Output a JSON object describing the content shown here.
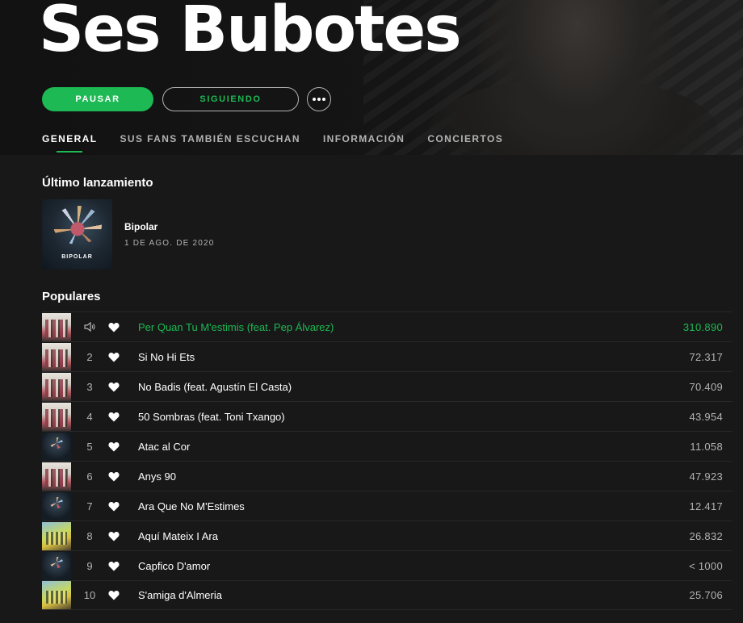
{
  "artist": {
    "name": "Ses Bubotes"
  },
  "actions": {
    "play_label": "PAUSAR",
    "follow_label": "SIGUIENDO"
  },
  "tabs": [
    {
      "label": "GENERAL",
      "active": true
    },
    {
      "label": "SUS FANS TAMBIÉN ESCUCHAN",
      "active": false
    },
    {
      "label": "INFORMACIÓN",
      "active": false
    },
    {
      "label": "CONCIERTOS",
      "active": false
    }
  ],
  "latest_release": {
    "heading": "Último lanzamiento",
    "cover_text": "BIPOLAR",
    "title": "Bipolar",
    "date": "1 DE AGO. DE 2020"
  },
  "popular": {
    "heading": "Populares",
    "tracks": [
      {
        "number": "1",
        "title": "Per Quan Tu M'estimis (feat. Pep Álvarez)",
        "plays": "310.890",
        "playing": true
      },
      {
        "number": "2",
        "title": "Si No Hi Ets",
        "plays": "72.317"
      },
      {
        "number": "3",
        "title": "No Badis (feat. Agustín El Casta)",
        "plays": "70.409"
      },
      {
        "number": "4",
        "title": "50 Sombras (feat. Toni Txango)",
        "plays": "43.954"
      },
      {
        "number": "5",
        "title": "Atac al Cor",
        "plays": "11.058"
      },
      {
        "number": "6",
        "title": "Anys 90",
        "plays": "47.923"
      },
      {
        "number": "7",
        "title": "Ara Que No M'Estimes",
        "plays": "12.417"
      },
      {
        "number": "8",
        "title": "Aquí Mateix I Ara",
        "plays": "26.832"
      },
      {
        "number": "9",
        "title": "Capfico D'amor",
        "plays": "< 1000"
      },
      {
        "number": "10",
        "title": "S'amiga d'Almeria",
        "plays": "25.706"
      }
    ]
  },
  "colors": {
    "accent": "#1db954",
    "background": "#181818",
    "muted_text": "#b3b3b3"
  },
  "icons": {
    "more": "more-horizontal-icon",
    "playing": "speaker-icon",
    "like": "heart-icon"
  }
}
